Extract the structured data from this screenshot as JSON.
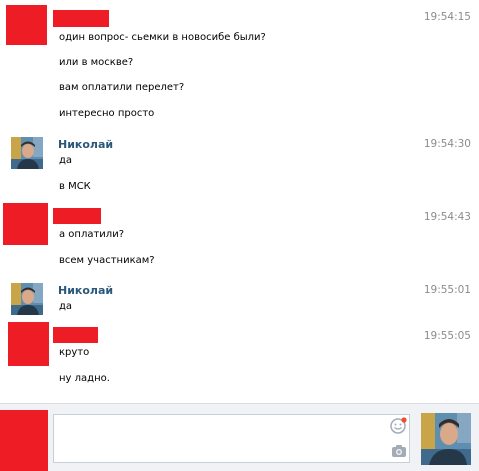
{
  "messages": [
    {
      "author": "",
      "author_redacted": true,
      "time": "19:54:15",
      "lines": [
        "один вопрос- сьемки в новосибе были?",
        "или в москве?",
        "вам оплатили перелет?",
        "интересно просто"
      ]
    },
    {
      "author": "Николай",
      "author_redacted": false,
      "time": "19:54:30",
      "lines": [
        "да",
        "в МСК"
      ]
    },
    {
      "author": "",
      "author_redacted": true,
      "time": "19:54:43",
      "lines": [
        "а оплатили?",
        "всем участникам?"
      ]
    },
    {
      "author": "Николай",
      "author_redacted": false,
      "time": "19:55:01",
      "lines": [
        "да"
      ]
    },
    {
      "author": "",
      "author_redacted": true,
      "time": "19:55:05",
      "lines": [
        "круто",
        "ну ладно."
      ]
    }
  ],
  "composer": {
    "value": "",
    "placeholder": "",
    "emoji_icon": "smile-icon",
    "camera_icon": "camera-icon"
  },
  "colors": {
    "redaction": "#ee1c25",
    "author_name": "#2b587a",
    "timestamp": "#8c8c8c"
  }
}
